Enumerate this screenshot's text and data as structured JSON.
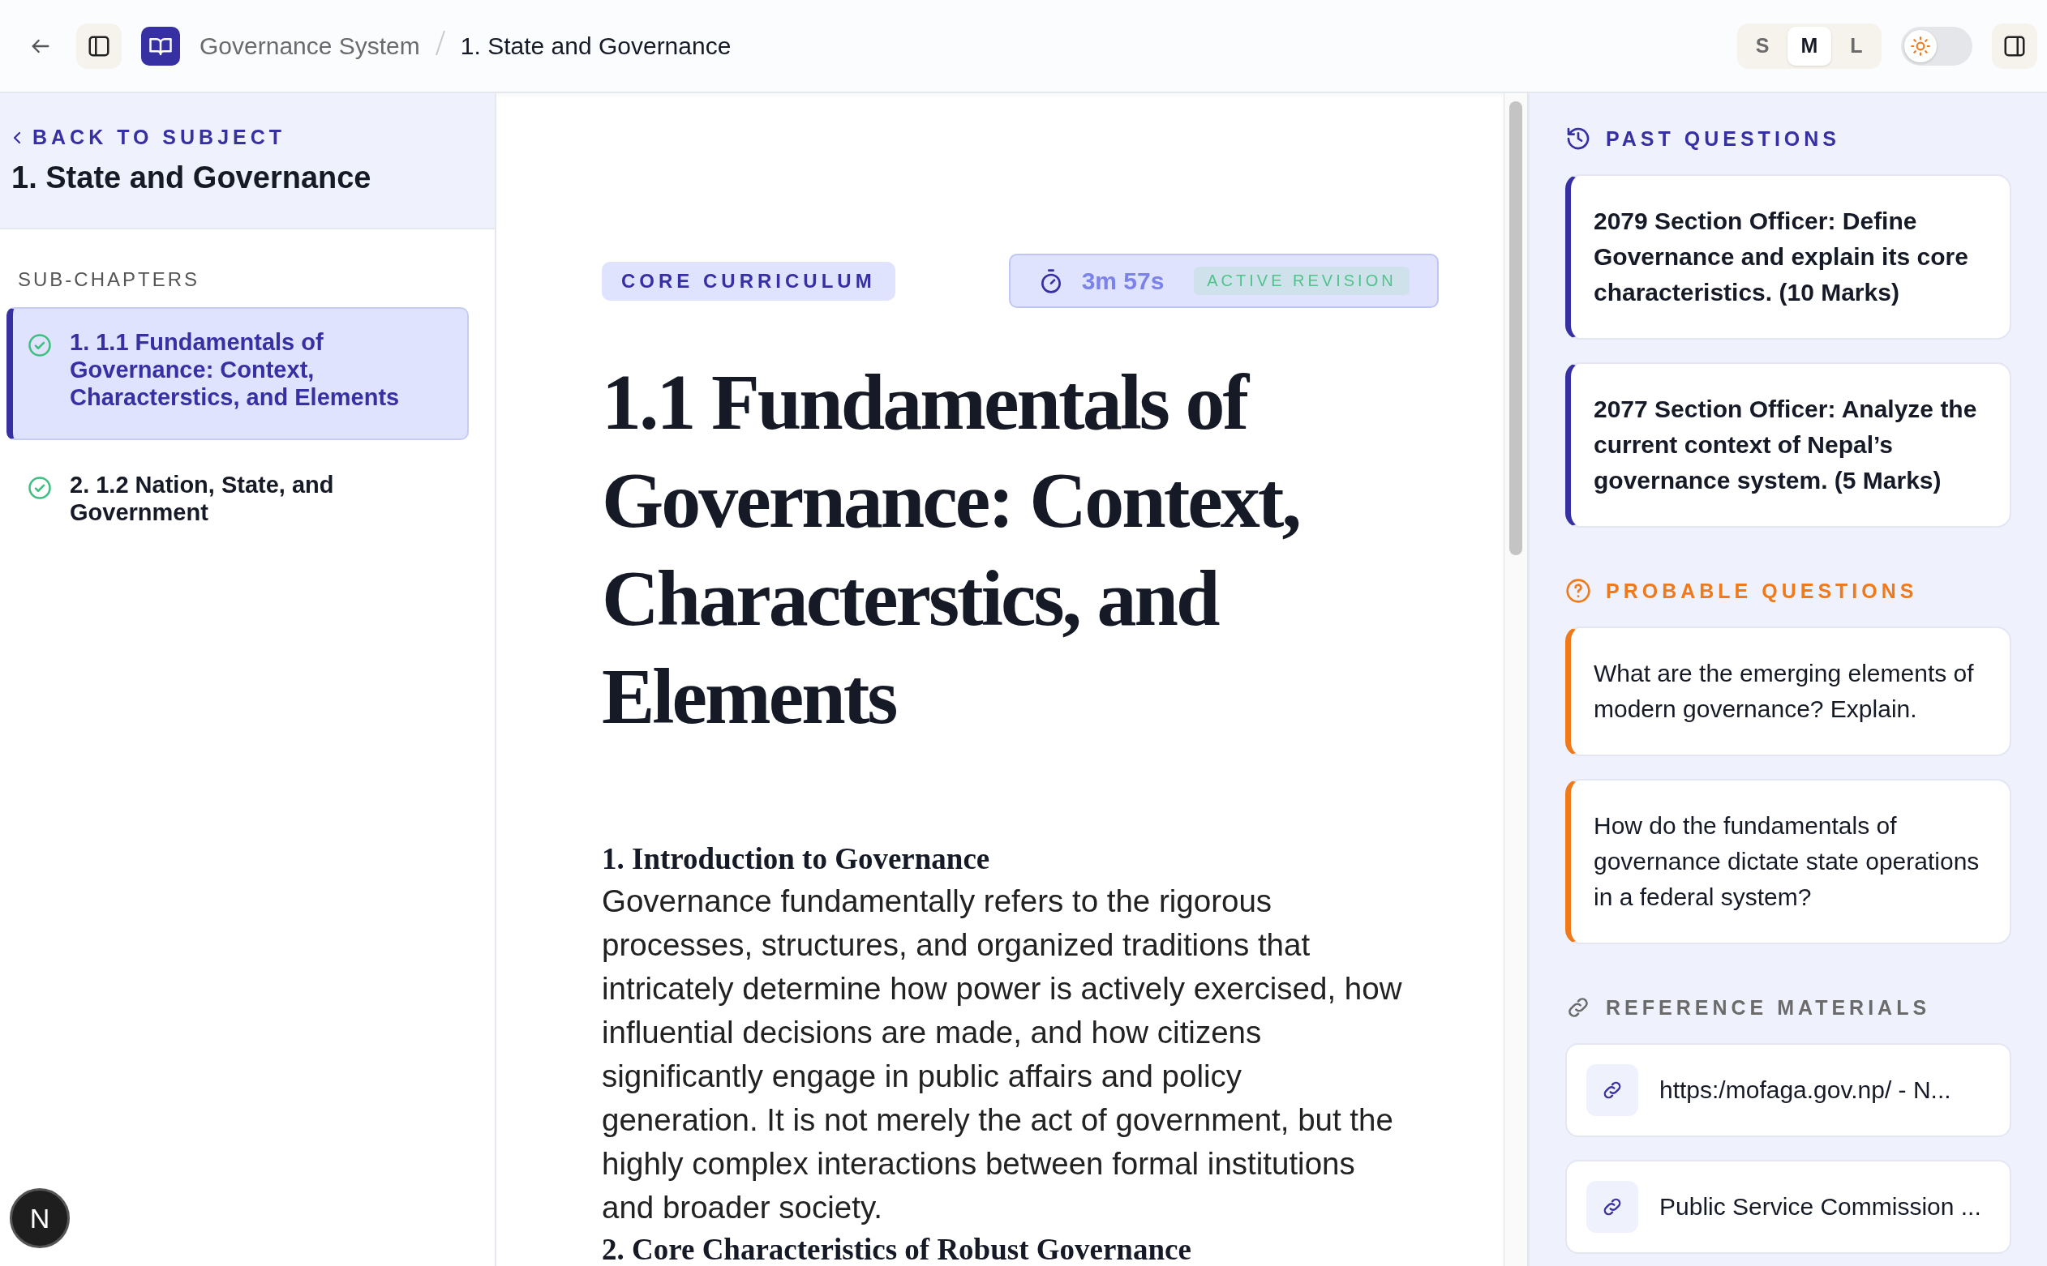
{
  "topbar": {
    "breadcrumb": [
      {
        "label": "Governance System",
        "current": false
      },
      {
        "label": "1. State and Governance",
        "current": true
      }
    ],
    "text_sizes": [
      {
        "label": "S",
        "selected": false
      },
      {
        "label": "M",
        "selected": true
      },
      {
        "label": "L",
        "selected": false
      }
    ],
    "dark_mode": false
  },
  "sidebar": {
    "back_link": "BACK TO SUBJECT",
    "title": "1. State and Governance",
    "section_label": "SUB-CHAPTERS",
    "items": [
      {
        "label": "1. 1.1 Fundamentals of Governance: Context, Characterstics, and Elements",
        "selected": true,
        "completed": true
      },
      {
        "label": "2. 1.2 Nation, State, and Government",
        "selected": false,
        "completed": true
      }
    ]
  },
  "main": {
    "tag": "CORE CURRICULUM",
    "timer": {
      "time": "3m 57s",
      "status": "ACTIVE REVISION"
    },
    "title": "1.1 Fundamentals of Governance: Context, Characterstics, and Elements",
    "sections": [
      {
        "heading": "1. Introduction to Governance",
        "body": "Governance fundamentally refers to the rigorous processes, structures, and organized traditions that intricately determine how power is actively exercised, how influential decisions are made, and how citizens significantly engage in public affairs and policy generation. It is not merely the act of government, but the highly complex interactions between formal institutions and broader society."
      },
      {
        "heading": "2. Core Characteristics of Robust Governance"
      }
    ]
  },
  "right_panel": {
    "sections": [
      {
        "kind": "past",
        "title": "PAST QUESTIONS",
        "items": [
          "2079 Section Officer: Define Governance and explain its core characteristics. (10 Marks)",
          "2077 Section Officer: Analyze the current context of Nepal’s governance system. (5 Marks)"
        ]
      },
      {
        "kind": "probable",
        "title": "PROBABLE QUESTIONS",
        "items": [
          "What are the emerging elements of modern governance? Explain.",
          "How do the fundamentals of governance dictate state operations in a federal system?"
        ]
      },
      {
        "kind": "references",
        "title": "REFERENCE MATERIALS",
        "items": [
          "https:/mofaga.gov.np/ - N...",
          "Public Service Commission ..."
        ]
      }
    ]
  },
  "dev_badge": "N"
}
